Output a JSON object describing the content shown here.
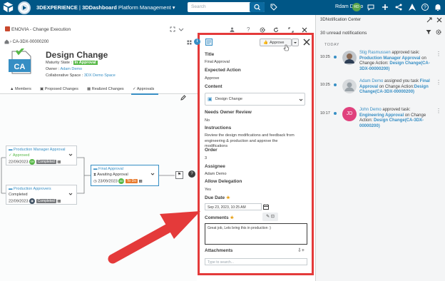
{
  "topbar": {
    "brand_prefix": "3DEXPERIENCE",
    "brand_sep": " | ",
    "brand_app": "3DDashboard",
    "brand_tab": "Platform Management",
    "search_placeholder": "Search",
    "user_name": "Rdam Demo",
    "user_initials": "RD"
  },
  "app": {
    "title": "ENOVIA - Change Execution",
    "breadcrumb": "CA-3DX-00000200",
    "object_title": "Design Change",
    "icon_text": "CA",
    "maturity_label": "Maturity State :",
    "maturity_value": "In Approval",
    "owner_label": "Owner :",
    "owner_value": "Adam Demo",
    "collab_label": "Collaborative Space :",
    "collab_value": "3DX Demo Space"
  },
  "tabs": [
    {
      "label": "Members"
    },
    {
      "label": "Proposed Changes"
    },
    {
      "label": "Realized Changes"
    },
    {
      "label": "Approvals"
    }
  ],
  "flow": {
    "box1": {
      "title": "Production Manager Approval",
      "status": "Approved",
      "date": "22/09/2023",
      "chip": "Completed",
      "avatar": "SR"
    },
    "box2": {
      "title": "Production Approvers",
      "status": "Completed",
      "date": "22/09/2023",
      "chip": "Completed"
    },
    "box3": {
      "title": "Final Approval",
      "status": "Awaiting Approval",
      "date": "23/09/2023",
      "avatar": "AD",
      "chip": "To Do"
    }
  },
  "panel": {
    "approve_label": "Approve",
    "title_label": "Title",
    "title_value": "Final Approval",
    "expected_label": "Expected Action",
    "expected_value": "Approve",
    "content_label": "Content",
    "content_value": "Design Change",
    "needs_review_label": "Needs Owner Review",
    "needs_review_value": "No",
    "instructions_label": "Instructions",
    "instructions_value": "Review the design modifications and feedback from engineering & production and approve the modifications",
    "order_label": "Order",
    "order_value": "3",
    "assignee_label": "Assignee",
    "assignee_value": "Adam Demo",
    "delegation_label": "Allow Delegation",
    "delegation_value": "Yes",
    "due_label": "Due Date",
    "due_value": "Sep 23, 2023, 10:25 AM",
    "comments_label": "Comments",
    "comments_value": "Great job, Lets bring this in production :)",
    "attachments_label": "Attachments",
    "attachments_search": "Type to search..."
  },
  "notifications": {
    "header": "3DNotification Center",
    "unread": "30 unread notifications",
    "section": "TODAY",
    "items": [
      {
        "time": "10:25",
        "name": "Stig Rasmussen",
        "action": " approved task: ",
        "task": "Production Manager Approval",
        "mid": " on Change Action: ",
        "target": "Design Change(CA-3DX-00000200)"
      },
      {
        "time": "10:25",
        "name": "Adam Demo",
        "action": " assigned you task ",
        "task": "Final Approval",
        "mid": " on Change Action:",
        "target": "Design Change(CA-3DX-00000200)"
      },
      {
        "time": "10:17",
        "name": "John Demo",
        "action": " approved task: ",
        "task": "Engineering Approval",
        "mid": " on Change Action: ",
        "target": "Design Change(CA-3DX-00000200)",
        "initials": "JD"
      }
    ]
  },
  "colors": {
    "topbar": "#005686",
    "accent": "#368ec4",
    "approved": "#57b847",
    "highlight_border": "#e43a3a",
    "todo": "#e87b2e"
  }
}
